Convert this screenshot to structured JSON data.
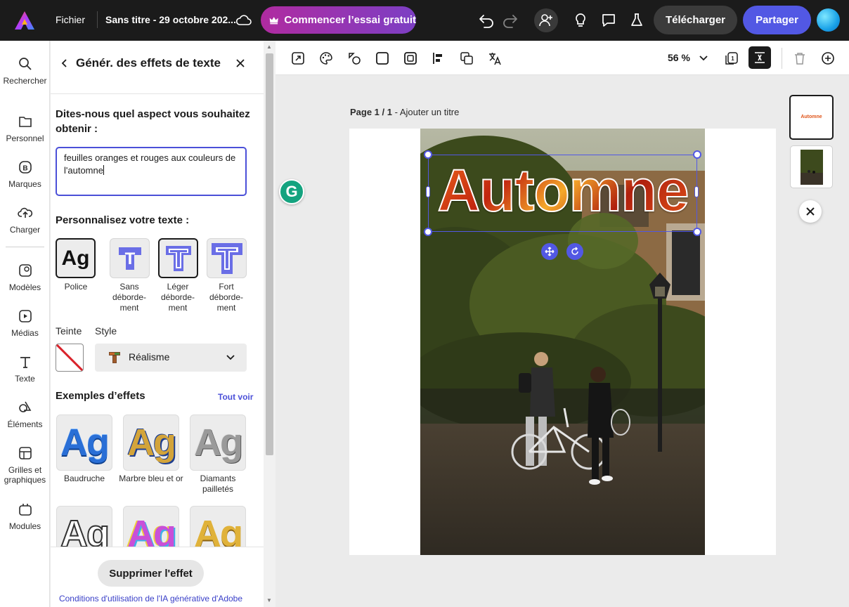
{
  "topbar": {
    "menu_label": "Fichier",
    "doc_title": "Sans titre - 29 octobre 202...",
    "trial_label": "Commencer l’essai gratuit",
    "download_label": "Télécharger",
    "share_label": "Partager"
  },
  "rail": {
    "items": [
      {
        "label": "Rechercher",
        "icon": "search-icon"
      },
      {
        "label": "Personnel",
        "icon": "folder-icon"
      },
      {
        "label": "Marques",
        "icon": "brand-icon"
      },
      {
        "label": "Charger",
        "icon": "upload-icon"
      },
      {
        "label": "Modèles",
        "icon": "templates-icon"
      },
      {
        "label": "Médias",
        "icon": "media-icon"
      },
      {
        "label": "Texte",
        "icon": "text-icon"
      },
      {
        "label": "Éléments",
        "icon": "elements-icon"
      },
      {
        "label": "Grilles et graphiques",
        "icon": "grid-icon"
      },
      {
        "label": "Modules",
        "icon": "addons-icon"
      }
    ]
  },
  "panel": {
    "title": "Génér. des effets de texte",
    "prompt_label": "Dites-nous quel aspect vous souhaitez obtenir :",
    "prompt_value": "feuilles oranges et rouges aux couleurs de l'automne",
    "customize_label": "Personnalisez votre texte :",
    "options": [
      {
        "label": "Police",
        "glyph": "Ag"
      },
      {
        "label": "Sans déborde-ment",
        "glyph": "T"
      },
      {
        "label": "Léger déborde-ment",
        "glyph": "T"
      },
      {
        "label": "Fort déborde-ment",
        "glyph": "T"
      }
    ],
    "tint_label": "Teinte",
    "style_label": "Style",
    "style_value": "Réalisme",
    "examples_label": "Exemples d’effets",
    "see_all_label": "Tout voir",
    "examples": [
      {
        "label": "Baudruche",
        "glyph": "Ag"
      },
      {
        "label": "Marbre bleu et or",
        "glyph": "Ag"
      },
      {
        "label": "Diamants pailletés",
        "glyph": "Ag"
      },
      {
        "label": "",
        "glyph": "Ag"
      },
      {
        "label": "",
        "glyph": "Ag"
      },
      {
        "label": "",
        "glyph": "Ag"
      }
    ],
    "remove_label": "Supprimer l'effet",
    "terms_label": "Conditions d'utilisation de l'IA générative d'Adobe"
  },
  "toolbar": {
    "zoom": "56 %"
  },
  "canvas": {
    "page_prefix": "Page 1 / 1",
    "page_title_placeholder": " - Ajouter un titre",
    "text_effect": "Automne",
    "thumb_text": "Automne"
  },
  "colors": {
    "accent": "#5258e4",
    "trial_gradient_start": "#b02ba0",
    "trial_gradient_end": "#7c3fc4",
    "text_effect": "#e0561b"
  }
}
